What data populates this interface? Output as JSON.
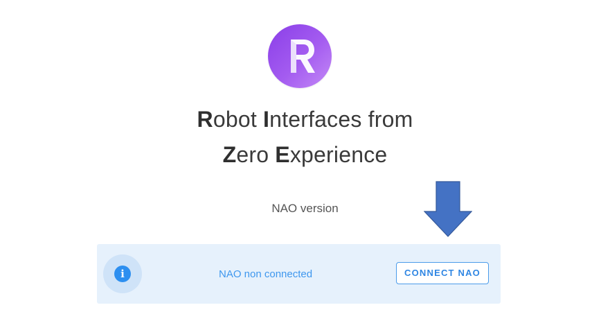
{
  "logo": {
    "icon": "r-letter-logo-icon",
    "gradient_colors": [
      "#8a3ee8",
      "#c48af6"
    ]
  },
  "title": {
    "line1": [
      {
        "text": "R",
        "bold": true
      },
      {
        "text": "obot ",
        "bold": false
      },
      {
        "text": "I",
        "bold": true
      },
      {
        "text": "nterfaces from",
        "bold": false
      }
    ],
    "line2": [
      {
        "text": "Z",
        "bold": true
      },
      {
        "text": "ero ",
        "bold": false
      },
      {
        "text": "E",
        "bold": true
      },
      {
        "text": "xperience",
        "bold": false
      }
    ]
  },
  "subtitle": "NAO version",
  "annotation": {
    "icon": "down-arrow-icon",
    "color": "#4472c4"
  },
  "banner": {
    "info_icon": "info-icon",
    "info_glyph": "i",
    "status_text": "NAO non connected",
    "connect_label": "CONNECT NAO",
    "background": "#e6f1fc",
    "accent": "#2d8ff0"
  }
}
